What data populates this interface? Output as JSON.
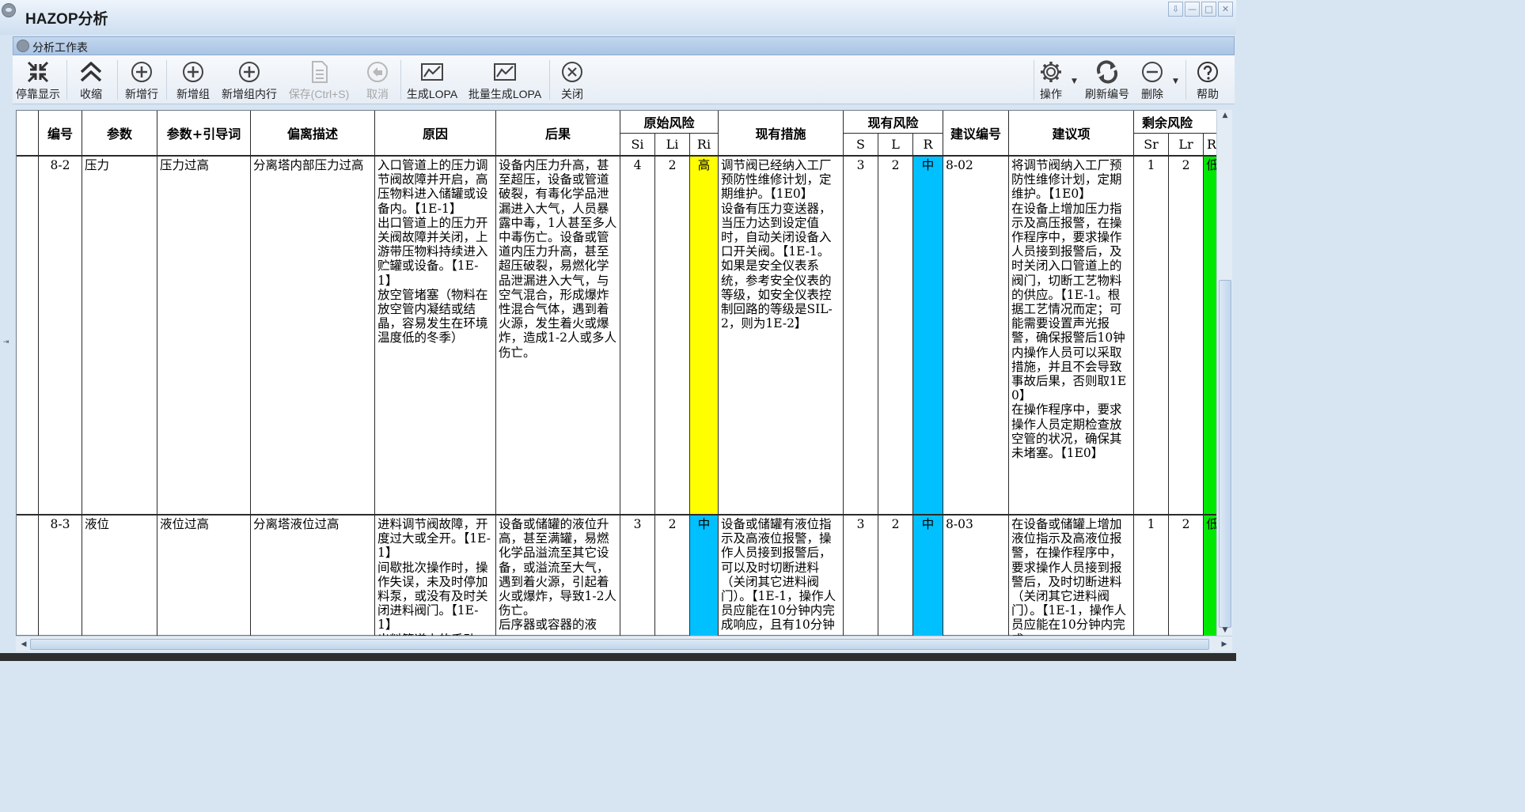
{
  "window": {
    "title": "HAZOP分析",
    "controls": [
      "⇩",
      "—",
      "□",
      "✕"
    ]
  },
  "panel": {
    "title": "分析工作表"
  },
  "toolbar": {
    "dock": "停靠显示",
    "collapse": "收缩",
    "add_row": "新增行",
    "add_group": "新增组",
    "add_group_row": "新增组内行",
    "save": "保存(Ctrl+S)",
    "cancel": "取消",
    "gen_lopa": "生成LOPA",
    "batch_lopa": "批量生成LOPA",
    "close": "关闭",
    "operate": "操作",
    "renumber": "刷新编号",
    "delete": "删除",
    "help": "帮助"
  },
  "colors": {
    "high": "#ffff00",
    "medium": "#00c0ff",
    "low": "#00e800"
  },
  "table": {
    "headers": {
      "no": "编号",
      "param": "参数",
      "param_guide": "参数+引导词",
      "deviation": "偏离描述",
      "cause": "原因",
      "consequence": "后果",
      "orig_risk": "原始风险",
      "si": "Si",
      "li": "Li",
      "ri": "Ri",
      "measures": "现有措施",
      "curr_risk": "现有风险",
      "s": "S",
      "l": "L",
      "r": "R",
      "sugg_no": "建议编号",
      "suggestion": "建议项",
      "resid_risk": "剩余风险",
      "sr": "Sr",
      "lr": "Lr",
      "rr": "R"
    },
    "rows": [
      {
        "no": "8-2",
        "param": "压力",
        "param_guide": "压力过高",
        "deviation": "分离塔内部压力过高",
        "cause": "入口管道上的压力调节阀故障并开启，高压物料进入储罐或设备内。【1E-1】\n出口管道上的压力开关阀故障并关闭，上游带压物料持续进入贮罐或设备。【1E-1】\n放空管堵塞（物料在放空管内凝结或结晶，容易发生在环境温度低的冬季）",
        "consequence": "设备内压力升高，甚至超压，设备或管道破裂，有毒化学品泄漏进入大气，人员暴露中毒，1人甚至多人中毒伤亡。设备或管道内压力升高，甚至超压破裂，易燃化学品泄漏进入大气，与空气混合，形成爆炸性混合气体，遇到着火源，发生着火或爆炸，造成1-2人或多人伤亡。",
        "si": "4",
        "li": "2",
        "ri": "高",
        "ri_level": "high",
        "measures": "调节阀已经纳入工厂预防性维修计划，定期维护。【1E0】\n设备有压力变送器，当压力达到设定值时，自动关闭设备入口开关阀。【1E-1。如果是安全仪表系统，参考安全仪表的等级，如安全仪表控制回路的等级是SIL-2，则为1E-2】",
        "s": "3",
        "l": "2",
        "r": "中",
        "r_level": "medium",
        "sugg_no": "8-02",
        "suggestion": "将调节阀纳入工厂预防性维修计划，定期维护。【1E0】\n在设备上增加压力指示及高压报警，在操作程序中，要求操作人员接到报警后，及时关闭入口管道上的阀门，切断工艺物料的供应。【1E-1。根据工艺情况而定；可能需要设置声光报警，确保报警后10钟内操作人员可以采取措施，并且不会导致事故后果，否则取1E0】\n在操作程序中，要求操作人员定期检查放空管的状况，确保其未堵塞。【1E0】",
        "sr": "1",
        "lr": "2",
        "rr": "低",
        "rr_level": "low"
      },
      {
        "no": "8-3",
        "param": "液位",
        "param_guide": "液位过高",
        "deviation": "分离塔液位过高",
        "cause": "进料调节阀故障，开度过大或全开。【1E-1】\n间歇批次操作时，操作失误，未及时停加料泵，或没有及时关闭进料阀门。【1E-1】\n出料管道上的手动",
        "consequence": "设备或储罐的液位升高，甚至满罐，易燃化学品溢流至其它设备，或溢流至大气，遇到着火源，引起着火或爆炸，导致1-2人伤亡。\n后序器或容器的液",
        "si": "3",
        "li": "2",
        "ri": "中",
        "ri_level": "medium",
        "measures": "设备或储罐有液位指示及高液位报警，操作人员接到报警后，可以及时切断进料（关闭其它进料阀门）。【1E-1，操作人员应能在10分钟内完成响应，且有10分钟",
        "s": "3",
        "l": "2",
        "r": "中",
        "r_level": "medium",
        "sugg_no": "8-03",
        "suggestion": "在设备或储罐上增加液位指示及高液位报警，在操作程序中，要求操作人员接到报警后，及时切断进料（关闭其它进料阀门）。【1E-1，操作人员应能在10分钟内完成",
        "sr": "1",
        "lr": "2",
        "rr": "低",
        "rr_level": "low"
      }
    ]
  }
}
